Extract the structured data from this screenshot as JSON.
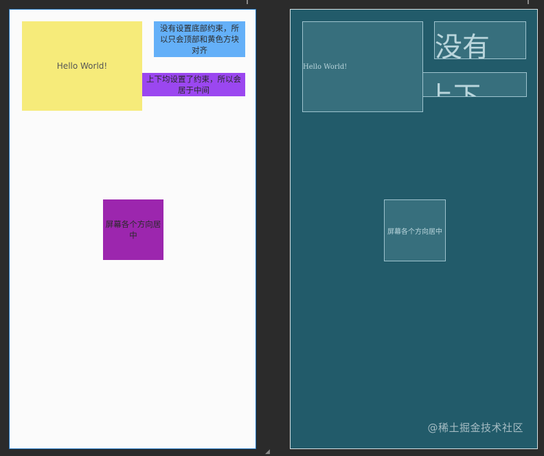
{
  "design": {
    "hello_world": "Hello World!",
    "top_right_text": "没有设置底部约束，所以只会顶部和黄色方块对齐",
    "middle_right_text": "上下均设置了约束，所以会居于中间",
    "center_text": "屏幕各个方向居中"
  },
  "blueprint": {
    "hello_world": "Hello World!",
    "top_right_text_preview": "没有",
    "middle_right_text_preview": "上下",
    "center_text": "屏幕各个方向居中"
  },
  "watermark": "@稀土掘金技术社区",
  "colors": {
    "canvas": "#2b2b2b",
    "design_background": "#fbfbfb",
    "design_border": "#1e73be",
    "yellow": "#f6eb7a",
    "blue": "#64b0f8",
    "violet": "#9b47f0",
    "magenta": "#9c26ae",
    "blueprint_background": "#225b6a",
    "blueprint_outline": "#9fc4cf"
  }
}
